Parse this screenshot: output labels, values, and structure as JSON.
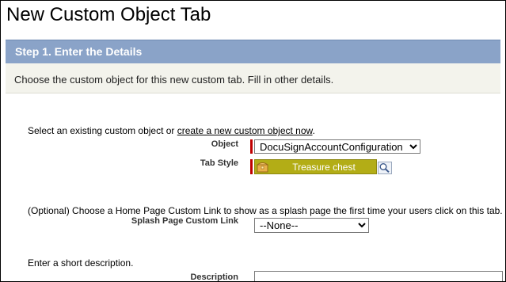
{
  "page": {
    "title": "New Custom Object Tab"
  },
  "step": {
    "header": "Step 1. Enter the Details"
  },
  "intro": {
    "text": "Choose the custom object for this new custom tab. Fill in other details."
  },
  "object_section": {
    "prompt_prefix": "Select an existing custom object or ",
    "create_link": "create a new custom object now",
    "prompt_suffix": ".",
    "object_label": "Object",
    "object_value": "DocuSignAccountConfiguration",
    "tab_style_label": "Tab Style",
    "tab_style_value": "Treasure chest",
    "tab_style_icon": "treasure-chest-icon",
    "lookup_icon": "magnifier-icon",
    "tab_style_color": "#b3ad16"
  },
  "splash_section": {
    "prompt": "(Optional) Choose a Home Page Custom Link to show as a splash page the first time your users click on this tab.",
    "label": "Splash Page Custom Link",
    "value": "--None--"
  },
  "description_section": {
    "prompt": "Enter a short description.",
    "label": "Description"
  },
  "colors": {
    "header_bg": "#8aa3c8",
    "intro_bg": "#f3f3ec",
    "required_bar": "#c00000"
  }
}
